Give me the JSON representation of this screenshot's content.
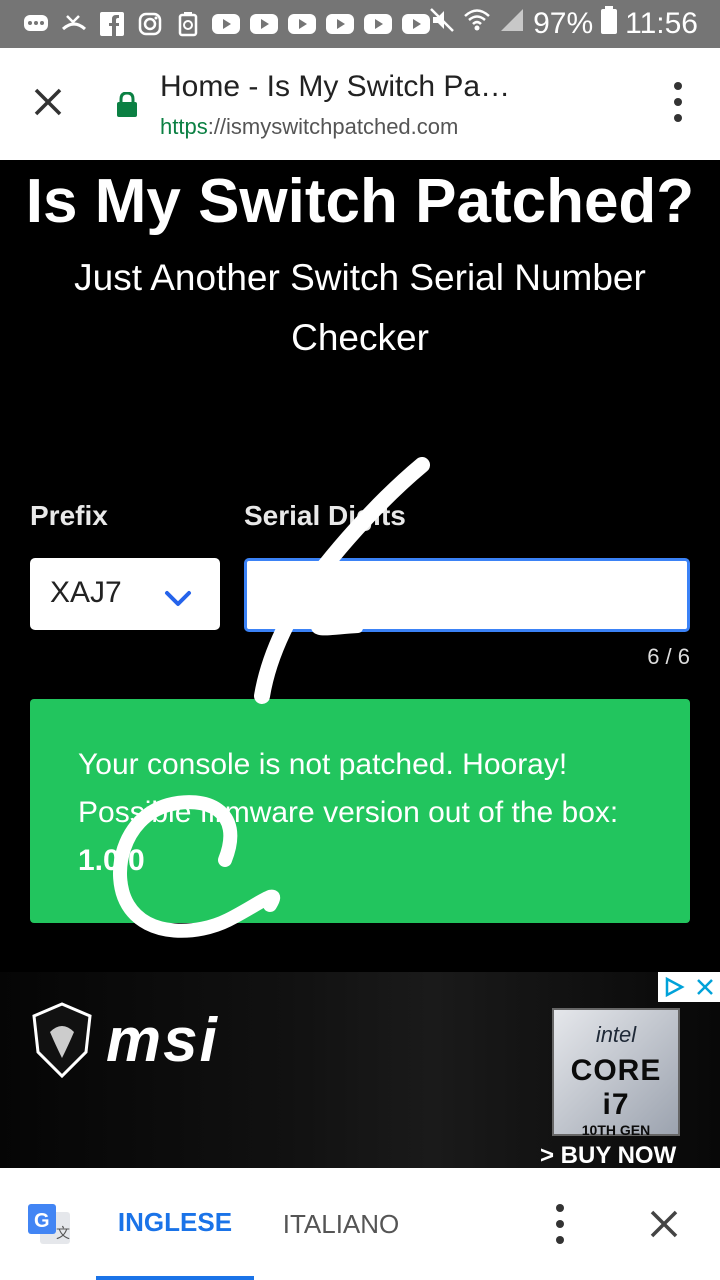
{
  "status_bar": {
    "battery": "97%",
    "time": "11:56",
    "icons": [
      "chat-icon",
      "missed-call-icon",
      "facebook-icon",
      "instagram-icon",
      "recycle-icon",
      "youtube-icon",
      "youtube-icon",
      "youtube-icon",
      "youtube-icon",
      "youtube-icon",
      "youtube-icon",
      "mute-icon",
      "wifi-icon",
      "signal-icon",
      "battery-icon"
    ]
  },
  "browser": {
    "title": "Home - Is My Switch Pa…",
    "url_scheme": "https",
    "url_rest": "://ismyswitchpatched.com"
  },
  "page": {
    "title": "Is My Switch Patched?",
    "subtitle": "Just Another Switch Serial Number Checker",
    "prefix_label": "Prefix",
    "serial_label": "Serial Digits",
    "prefix_value": "XAJ7",
    "serial_value": "",
    "counter": "6 / 6",
    "result_line": "Your console is not patched. Hooray! Possible firmware version out of the box:",
    "result_version": "1.0.0"
  },
  "ad": {
    "brand": "msi",
    "badge_intel": "intel",
    "badge_core": "CORE i7",
    "badge_gen": "10TH GEN",
    "cta": "> BUY NOW"
  },
  "translate": {
    "source_lang": "INGLESE",
    "target_lang": "ITALIANO"
  },
  "colors": {
    "status_bar": "#757575",
    "result_green": "#22c55e",
    "link_blue": "#1a73e8",
    "lock_green": "#0b8043"
  }
}
